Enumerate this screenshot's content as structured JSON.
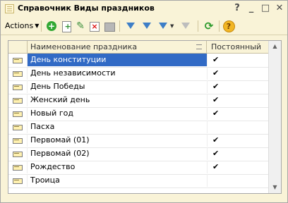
{
  "window": {
    "title": "Справочник Виды праздников"
  },
  "titlebar": {
    "help_button": "?",
    "minimize_button": "_",
    "maximize_button": "□",
    "close_button": "✕"
  },
  "toolbar": {
    "actions_label": "Actions"
  },
  "grid": {
    "columns": [
      "Наименование праздника",
      "Постоянный"
    ],
    "rows": [
      {
        "name": "День конституции",
        "permanent": "✔",
        "selected": true
      },
      {
        "name": "День независимости",
        "permanent": "✔",
        "selected": false
      },
      {
        "name": "День Победы",
        "permanent": "✔",
        "selected": false
      },
      {
        "name": "Женский день",
        "permanent": "✔",
        "selected": false
      },
      {
        "name": "Новый год",
        "permanent": "✔",
        "selected": false
      },
      {
        "name": "Пасха",
        "permanent": "",
        "selected": false
      },
      {
        "name": "Первомай (01)",
        "permanent": "✔",
        "selected": false
      },
      {
        "name": "Первомай (02)",
        "permanent": "✔",
        "selected": false
      },
      {
        "name": "Рождество",
        "permanent": "✔",
        "selected": false
      },
      {
        "name": "Троица",
        "permanent": "",
        "selected": false
      }
    ]
  },
  "colors": {
    "window_bg": "#f9f3d7",
    "selection": "#316ac5"
  }
}
